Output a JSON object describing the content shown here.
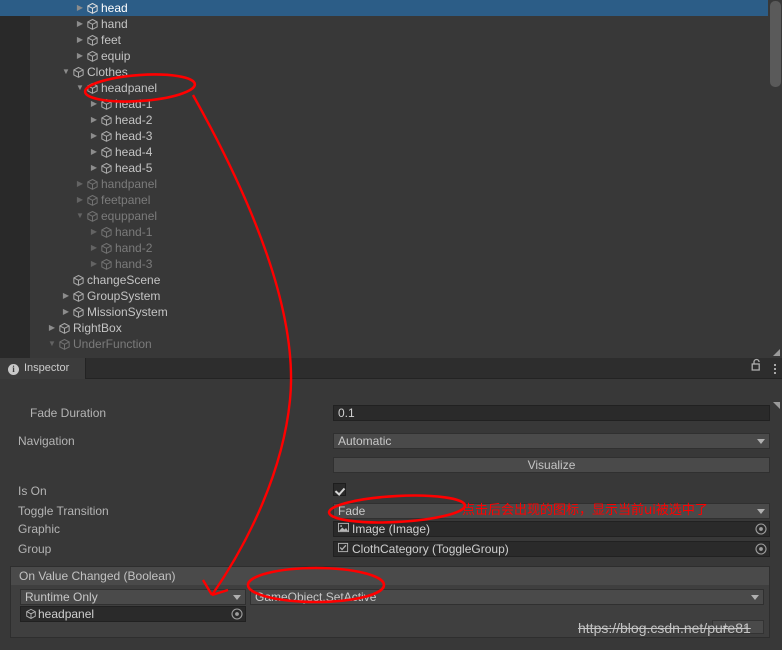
{
  "hierarchy": {
    "panel_name": "Hierarchy",
    "rows": [
      {
        "label": "head",
        "indent": 4,
        "arrow": "right",
        "state": "selected"
      },
      {
        "label": "hand",
        "indent": 4,
        "arrow": "right",
        "state": "normal"
      },
      {
        "label": "feet",
        "indent": 4,
        "arrow": "right",
        "state": "normal"
      },
      {
        "label": "equip",
        "indent": 4,
        "arrow": "right",
        "state": "normal"
      },
      {
        "label": "Clothes",
        "indent": 3,
        "arrow": "down",
        "state": "normal"
      },
      {
        "label": "headpanel",
        "indent": 4,
        "arrow": "down",
        "state": "normal"
      },
      {
        "label": "head-1",
        "indent": 5,
        "arrow": "right",
        "state": "normal"
      },
      {
        "label": "head-2",
        "indent": 5,
        "arrow": "right",
        "state": "normal"
      },
      {
        "label": "head-3",
        "indent": 5,
        "arrow": "right",
        "state": "normal"
      },
      {
        "label": "head-4",
        "indent": 5,
        "arrow": "right",
        "state": "normal"
      },
      {
        "label": "head-5",
        "indent": 5,
        "arrow": "right",
        "state": "normal"
      },
      {
        "label": "handpanel",
        "indent": 4,
        "arrow": "right",
        "state": "dim"
      },
      {
        "label": "feetpanel",
        "indent": 4,
        "arrow": "right",
        "state": "dim"
      },
      {
        "label": "equppanel",
        "indent": 4,
        "arrow": "down",
        "state": "dim"
      },
      {
        "label": "hand-1",
        "indent": 5,
        "arrow": "right",
        "state": "dim"
      },
      {
        "label": "hand-2",
        "indent": 5,
        "arrow": "right",
        "state": "dim"
      },
      {
        "label": "hand-3",
        "indent": 5,
        "arrow": "right",
        "state": "dim"
      },
      {
        "label": "changeScene",
        "indent": 3,
        "arrow": "none",
        "state": "normal"
      },
      {
        "label": "GroupSystem",
        "indent": 3,
        "arrow": "right",
        "state": "normal"
      },
      {
        "label": "MissionSystem",
        "indent": 3,
        "arrow": "right",
        "state": "normal"
      },
      {
        "label": "RightBox",
        "indent": 2,
        "arrow": "right",
        "state": "normal"
      },
      {
        "label": "UnderFunction",
        "indent": 2,
        "arrow": "down",
        "state": "dim"
      },
      {
        "label": "",
        "indent": 3,
        "arrow": "none",
        "state": "dim"
      }
    ]
  },
  "inspector": {
    "tab_label": "Inspector",
    "lock_icon": "lock-open-icon",
    "menu_icon": "kebab-menu-icon",
    "properties": [
      {
        "name": "Fade Duration",
        "value": "0.1",
        "kind": "text",
        "indented": true
      },
      {
        "name": "Navigation",
        "value": "Automatic",
        "kind": "popup",
        "indented": false
      },
      {
        "name": "",
        "value": "Visualize",
        "kind": "button",
        "indented": false
      },
      {
        "name": "Is On",
        "value": "checked",
        "kind": "checkbox",
        "indented": false
      },
      {
        "name": "Toggle Transition",
        "value": "Fade",
        "kind": "popup",
        "indented": false
      },
      {
        "name": "Graphic",
        "value": "Image (Image)",
        "kind": "object",
        "indented": false,
        "icon": "image-icon"
      },
      {
        "name": "Group",
        "value": "ClothCategory (ToggleGroup)",
        "kind": "object",
        "indented": false,
        "icon": "togglegroup-icon"
      }
    ],
    "event": {
      "header": "On Value Changed (Boolean)",
      "mode": "Runtime Only",
      "target_object": "headpanel",
      "function": "GameObject.SetActive",
      "add_remove": "+ -"
    }
  },
  "annotations": {
    "chinese_note": "点击后会出现的图标，显示当前ui被选中了",
    "ink_color": "#ff0000",
    "circled_items": [
      "headpanel-tree-row",
      "graphic-image-field",
      "gameobject-setactive-function"
    ]
  },
  "watermark": {
    "text": "https://blog.csdn.net/pure81"
  }
}
